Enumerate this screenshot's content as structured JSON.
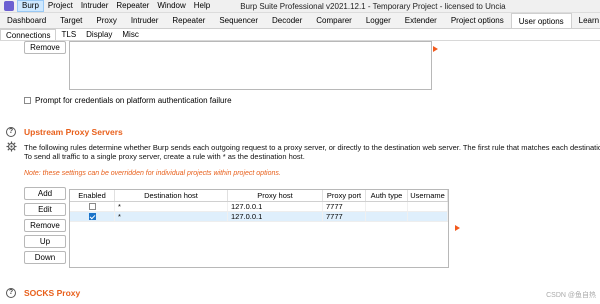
{
  "menubar": {
    "items": [
      "Burp",
      "Project",
      "Intruder",
      "Repeater",
      "Window",
      "Help"
    ],
    "active_index": 0,
    "window_title": "Burp Suite Professional v2021.12.1 - Temporary Project - licensed to Uncia"
  },
  "tabs": [
    "Dashboard",
    "Target",
    "Proxy",
    "Intruder",
    "Repeater",
    "Sequencer",
    "Decoder",
    "Comparer",
    "Logger",
    "Extender",
    "Project options",
    "User options",
    "Learn"
  ],
  "active_tab": "User options",
  "subtabs": [
    "Connections",
    "TLS",
    "Display",
    "Misc"
  ],
  "active_subtab": "Connections",
  "platform_auth": {
    "remove_label": "Remove",
    "prompt_label": "Prompt for credentials on platform authentication failure"
  },
  "upstream": {
    "title": "Upstream Proxy Servers",
    "description_line1": "The following rules determine whether Burp sends each outgoing request to a proxy server, or directly to the destination web server. The first rule that matches each destination",
    "description_line2": "To send all traffic to a single proxy server, create a rule with * as the destination host.",
    "note": "Note: these settings can be overridden for individual projects within project options.",
    "buttons": {
      "add": "Add",
      "edit": "Edit",
      "remove": "Remove",
      "up": "Up",
      "down": "Down"
    },
    "columns": [
      "Enabled",
      "Destination host",
      "Proxy host",
      "Proxy port",
      "Auth type",
      "Username"
    ],
    "rows": [
      {
        "enabled": false,
        "destination_host": "*",
        "proxy_host": "127.0.0.1",
        "proxy_port": "7777",
        "auth_type": "",
        "username": ""
      },
      {
        "enabled": true,
        "destination_host": "*",
        "proxy_host": "127.0.0.1",
        "proxy_port": "7777",
        "auth_type": "",
        "username": ""
      }
    ]
  },
  "socks": {
    "title": "SOCKS Proxy"
  },
  "watermark": "CSDN @鱼自热",
  "colors": {
    "accent": "#e8601c",
    "checkbox_checked": "#1a73c9",
    "selected_row": "#dfeffc"
  }
}
